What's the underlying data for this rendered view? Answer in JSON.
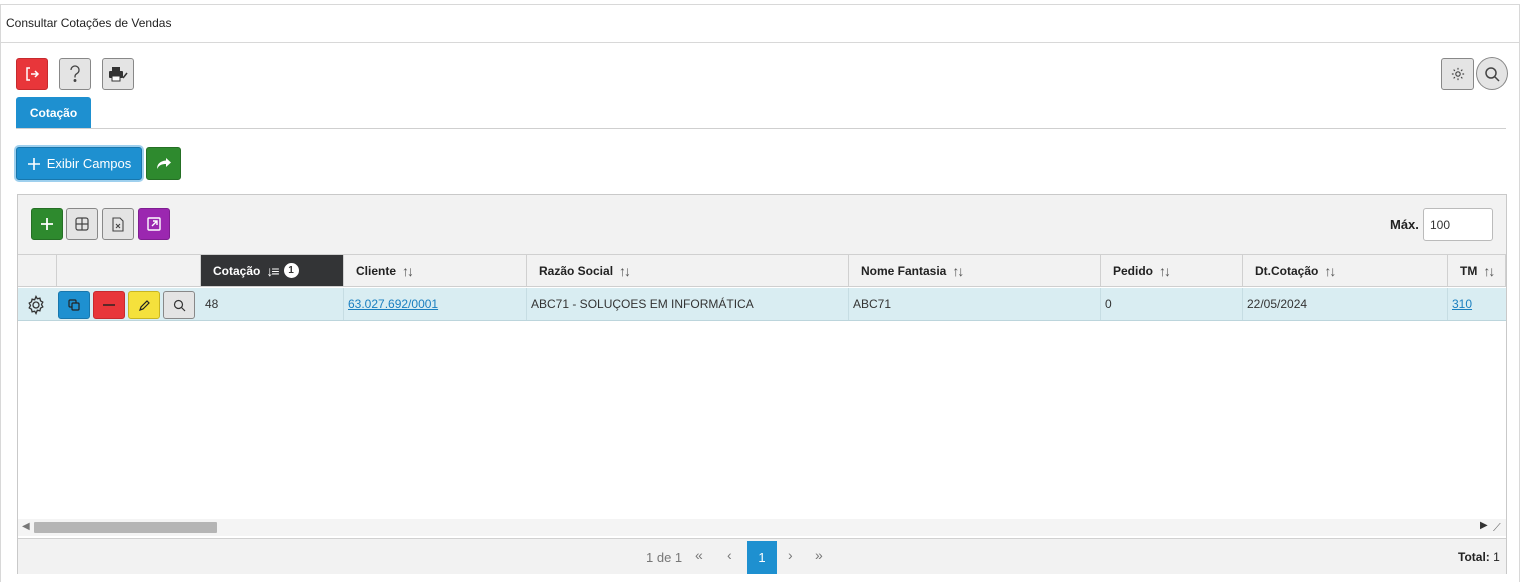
{
  "window": {
    "title": "Consultar Cotações de Vendas"
  },
  "tabs": [
    {
      "label": "Cotação",
      "active": true
    }
  ],
  "toolbar": {
    "exibir_campos_label": "Exibir Campos"
  },
  "grid": {
    "max_label": "Máx.",
    "max_value": "100",
    "columns": [
      {
        "key": "cotacao",
        "label": "Cotação",
        "sorted": true,
        "sort_order": "1"
      },
      {
        "key": "cliente",
        "label": "Cliente"
      },
      {
        "key": "razao_social",
        "label": "Razão Social"
      },
      {
        "key": "nome_fantasia",
        "label": "Nome Fantasia"
      },
      {
        "key": "pedido",
        "label": "Pedido"
      },
      {
        "key": "dt_cotacao",
        "label": "Dt.Cotação"
      },
      {
        "key": "tm",
        "label": "TM"
      }
    ],
    "rows": [
      {
        "cotacao": "48",
        "cliente": "63.027.692/0001",
        "razao_social": "ABC71 - SOLUÇOES EM INFORMÁTICA",
        "nome_fantasia": "ABC71",
        "pedido": "0",
        "dt_cotacao": "22/05/2024",
        "tm": "310"
      }
    ]
  },
  "pager": {
    "info": "1 de 1",
    "first": "«",
    "prev": "‹",
    "current": "1",
    "next": "›",
    "last": "»",
    "total_label": "Total:",
    "total_value": "1"
  },
  "colors": {
    "primary": "#1e90d0",
    "danger": "#e8363a",
    "success": "#2e8a2e",
    "warning": "#f5e13c",
    "purple": "#9b27b0",
    "row_selected": "#d9edf2",
    "header_active": "#333436"
  },
  "icons": {
    "exit": "logout-icon",
    "help": "question-icon",
    "print": "printer-icon",
    "settings": "gear-icon",
    "search": "search-icon",
    "add": "plus-icon",
    "columns": "grid-columns-icon",
    "excel": "excel-file-icon",
    "export": "external-link-icon",
    "share": "share-arrow-icon",
    "copy": "copy-icon",
    "delete": "minus-icon",
    "edit": "pencil-icon",
    "view": "magnifier-icon"
  }
}
